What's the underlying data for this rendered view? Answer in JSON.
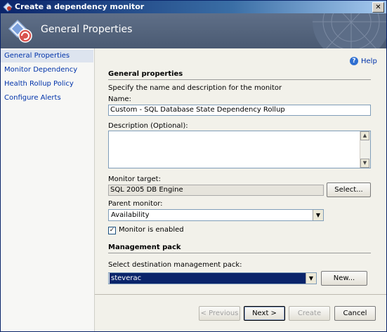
{
  "window": {
    "title": "Create a dependency monitor",
    "close": "✕"
  },
  "banner": {
    "title": "General Properties"
  },
  "nav": [
    {
      "label": "General Properties",
      "selected": true
    },
    {
      "label": "Monitor Dependency"
    },
    {
      "label": "Health Rollup Policy"
    },
    {
      "label": "Configure Alerts"
    }
  ],
  "help": {
    "label": "Help",
    "icon": "?"
  },
  "general": {
    "heading": "General properties",
    "instructions": "Specify the name and description for the monitor",
    "name_label": "Name:",
    "name_value": "Custom - SQL Database State Dependency Rollup",
    "description_label": "Description (Optional):",
    "description_value": "",
    "target_label": "Monitor target:",
    "target_value": "SQL 2005 DB Engine",
    "select_button": "Select...",
    "parent_label": "Parent monitor:",
    "parent_value": "Availability",
    "enabled_label": "Monitor is enabled",
    "enabled_checked": true
  },
  "mp": {
    "heading": "Management pack",
    "select_label": "Select destination management pack:",
    "selected_value": "steverac",
    "new_button": "New..."
  },
  "footer": {
    "previous": "< Previous",
    "next": "Next >",
    "create": "Create",
    "cancel": "Cancel"
  },
  "colors": {
    "title_bar": "#0a246a",
    "banner": "#4a5a72",
    "link": "#0033aa",
    "selection": "#0a246a"
  }
}
